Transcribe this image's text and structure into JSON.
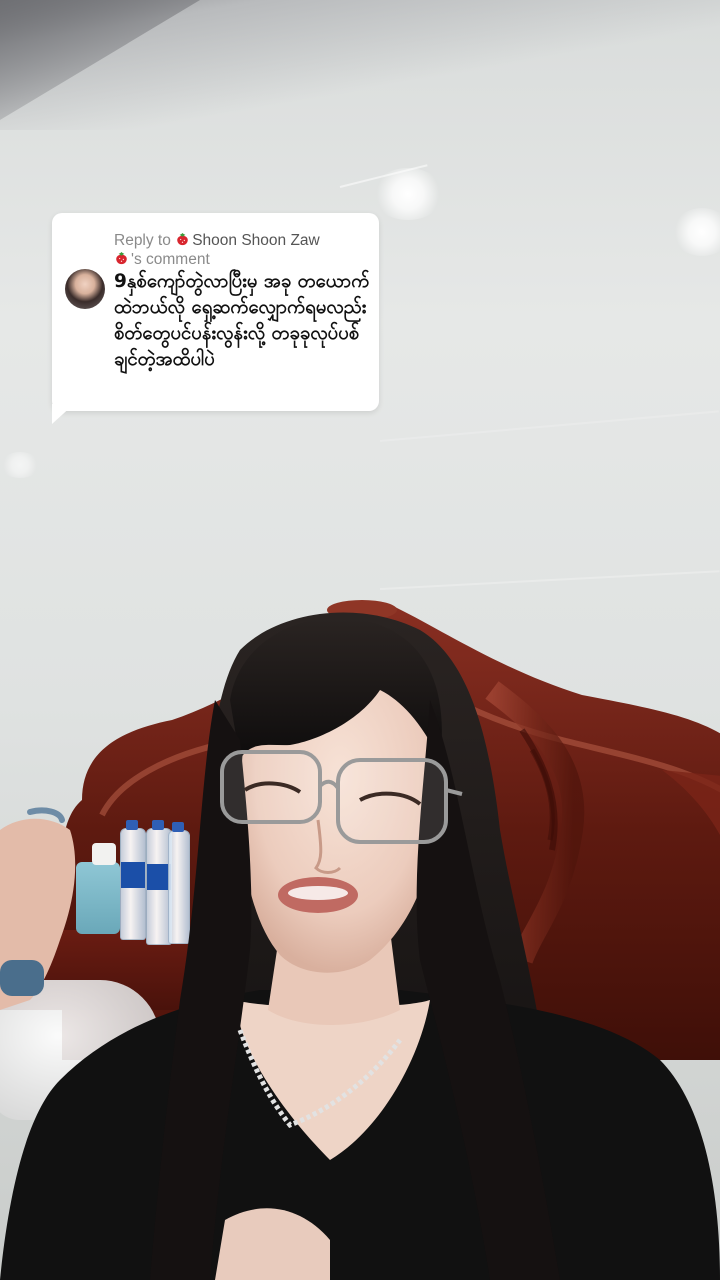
{
  "comment_reply": {
    "reply_prefix": "Reply to",
    "commenter_name": "Shoon Shoon Zaw",
    "reply_suffix": "'s comment",
    "comment_text": "9နှစ်ကျော်တွဲလာပြီးမှ အခု တယောက်ထဲဘယ်လို ရှေ့ဆက်လျှောက်ရမလည်း စိတ်တွေပင်ပန်းလွန်းလို့ တခုခုလုပ်ပစ်ချင်တဲ့အထိပါပဲ",
    "emoji_icon": "strawberry-icon"
  },
  "colors": {
    "card_background": "#ffffff",
    "reply_text": "#8a8a8a",
    "comment_text": "#111111",
    "headboard_wood": "#6b1e14"
  }
}
